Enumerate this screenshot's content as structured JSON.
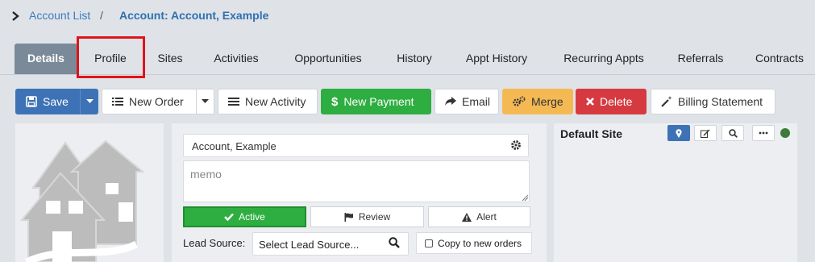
{
  "breadcrumb": {
    "parent": "Account List",
    "separator": "/",
    "current": "Account: Account, Example"
  },
  "tabs": [
    {
      "label": "Details",
      "active": true
    },
    {
      "label": "Profile",
      "highlighted": true
    },
    {
      "label": "Sites"
    },
    {
      "label": "Activities"
    },
    {
      "label": "Opportunities"
    },
    {
      "label": "History"
    },
    {
      "label": "Appt History"
    },
    {
      "label": "Recurring Appts"
    },
    {
      "label": "Referrals"
    },
    {
      "label": "Contracts"
    }
  ],
  "toolbar": {
    "save": "Save",
    "new_order": "New Order",
    "new_activity": "New Activity",
    "new_payment": "New Payment",
    "email": "Email",
    "merge": "Merge",
    "delete": "Delete",
    "billing_statement": "Billing Statement"
  },
  "account": {
    "name": "Account, Example",
    "memo_placeholder": "memo",
    "status_active": "Active",
    "status_review": "Review",
    "status_alert": "Alert",
    "lead_source_label": "Lead Source:",
    "lead_source_value": "Select Lead Source...",
    "copy_to_orders": "Copy to new orders"
  },
  "site": {
    "title": "Default Site",
    "status_color": "#3e7a3a"
  },
  "colors": {
    "primary": "#3e72b6",
    "success": "#2eae41",
    "warning": "#f5b954",
    "danger": "#d63a41",
    "tab_active": "#7b8a99",
    "highlight": "#e0141a"
  }
}
